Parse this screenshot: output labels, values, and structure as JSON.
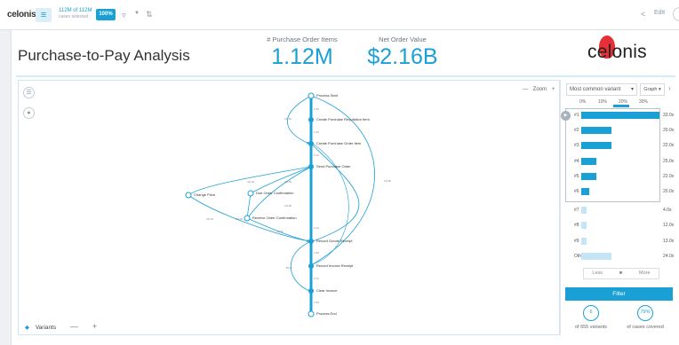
{
  "toolbar": {
    "logo": "celonis",
    "selection_count": "112M of 112M",
    "selection_sub": "cases selected",
    "percent_badge": "100%",
    "edit_label": "Edit"
  },
  "header": {
    "title": "Purchase-to-Pay Analysis",
    "kpis": [
      {
        "label": "# Purchase Order Items",
        "value": "1.12M"
      },
      {
        "label": "Net Order Value",
        "value": "$2.16B"
      }
    ],
    "brand": "celonis"
  },
  "process": {
    "zoom_label": "Zoom",
    "variants_label": "Variants",
    "nodes": [
      {
        "label": "Process Start"
      },
      {
        "label": "Create Purchase Requisition Item"
      },
      {
        "label": "Create Purchase Order Item"
      },
      {
        "label": "Send Purchase Order"
      },
      {
        "label": "Change Price"
      },
      {
        "label": "Due Order Confirmation"
      },
      {
        "label": "Receive Order Confirmation"
      },
      {
        "label": "Record Goods Receipt"
      },
      {
        "label": "Record Invoice Receipt"
      },
      {
        "label": "Clear Invoice"
      },
      {
        "label": "Process End"
      }
    ]
  },
  "variants": {
    "selector": "Most common variant",
    "view_selector": "Graph",
    "axis": [
      "0%",
      "10%",
      "20%",
      "30%"
    ],
    "rows": [
      {
        "label": "#1",
        "percent": 31,
        "value": "33.0x",
        "highlight": true
      },
      {
        "label": "#2",
        "percent": 12,
        "value": "20.0x",
        "highlight": true
      },
      {
        "label": "#3",
        "percent": 12,
        "value": "22.0x",
        "highlight": true
      },
      {
        "label": "#4",
        "percent": 6,
        "value": "25.0x",
        "highlight": true
      },
      {
        "label": "#5",
        "percent": 6,
        "value": "22.0x",
        "highlight": true
      },
      {
        "label": "#6",
        "percent": 3,
        "value": "20.0x",
        "highlight": true
      },
      {
        "label": "#7",
        "percent": 2,
        "value": "4.0x",
        "highlight": false
      },
      {
        "label": "#8",
        "percent": 2,
        "value": "12.0x",
        "highlight": false
      },
      {
        "label": "#9",
        "percent": 2,
        "value": "13.0x",
        "highlight": false
      },
      {
        "label": "Others",
        "percent": 12,
        "value": "24.0x",
        "highlight": false
      }
    ],
    "pager_less": "Less",
    "pager_more": "More",
    "filter_label": "Filter",
    "variant_count": "6",
    "variant_total": "of 655 variants",
    "coverage": "79%",
    "coverage_label": "of cases covered"
  }
}
